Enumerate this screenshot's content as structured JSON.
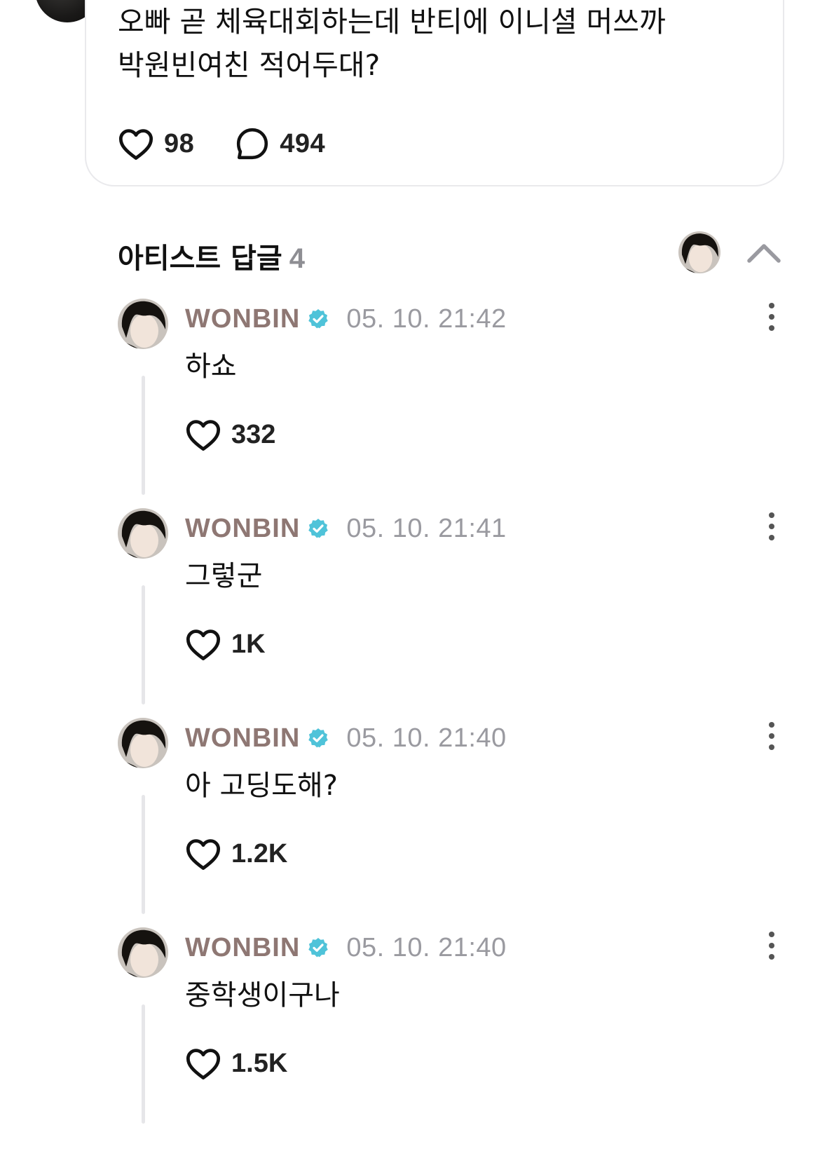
{
  "post": {
    "body": "오빠 곧 체육대회하는데 반티에 이니셜 머쓰까\n박원빈여친 적어두대?",
    "like_count": "98",
    "comment_count": "494"
  },
  "replies_header": {
    "title": "아티스트 답글",
    "count": "4"
  },
  "replies": [
    {
      "author": "WONBIN",
      "timestamp": "05. 10. 21:42",
      "text": "하쇼",
      "likes": "332"
    },
    {
      "author": "WONBIN",
      "timestamp": "05. 10. 21:41",
      "text": "그렇군",
      "likes": "1K"
    },
    {
      "author": "WONBIN",
      "timestamp": "05. 10. 21:40",
      "text": "아 고딩도해?",
      "likes": "1.2K"
    },
    {
      "author": "WONBIN",
      "timestamp": "05. 10. 21:40",
      "text": "중학생이구나",
      "likes": "1.5K"
    }
  ],
  "icons": {
    "like": "heart-icon",
    "comment": "comment-bubble-icon",
    "verified": "verified-badge-icon",
    "more": "more-vertical-icon",
    "collapse": "chevron-up-icon"
  },
  "colors": {
    "author": "#8e7773",
    "verified": "#4fc3d9",
    "timestamp": "#9a9aa0",
    "muted_count": "#8e8e93"
  }
}
